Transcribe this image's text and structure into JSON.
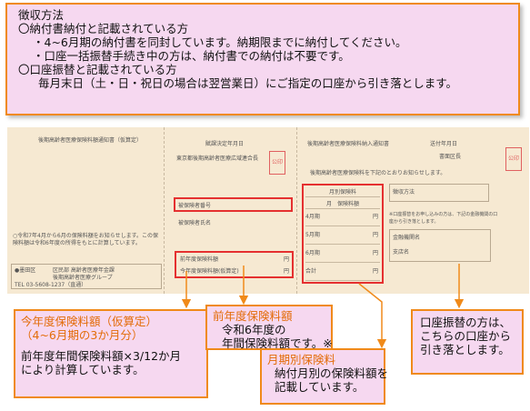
{
  "top_box": {
    "lines": [
      "徴収方法",
      "〇納付書納付と記載されている方",
      "・4~6月期の納付書を同封しています。納期限までに納付してください。",
      "・口座一括振替手続き中の方は、納付書での納付は不要です。",
      "〇口座振替と記載されている方",
      "毎月末日（土・日・祝日の場合は翌営業日）にご指定の口座から引き落とします。"
    ]
  },
  "notice": {
    "left_title": "後期高齢者医療保険料額通知書（仮算定）",
    "center_title": "賦課決定年月日",
    "center_org": "東京都後期高齢者医療広域連合長",
    "stamp": "公印",
    "right_title": "後期高齢者医療保険料納入通知書",
    "right_date": "送付年月日",
    "right_issuer": "書面区長",
    "right_intro": "後期高齢者医療保険料を下記のとおりお知らせします。",
    "insured_number": "被保険者番号",
    "insured_name": "被保険者氏名",
    "prev_year_premium": "前年度保険料額",
    "current_year_premium": "今年度保険料額(仮算定)",
    "yen": "円",
    "monthly_table_title": "月別保険料",
    "monthly_header": "月　保険料額",
    "monthly_rows": [
      "4月期",
      "5月期",
      "6月期",
      "合計"
    ],
    "collection_method": "徴収方法",
    "transfer_note": "※口座振替をお申し込みの方は、下記の金融機関の口座から引き落とします。",
    "bank_name": "金融機関名",
    "bank_branch": "支店名",
    "left_note": "○令和7年4月から6月の保険料額をお知らせします。この保険料額は令和6年度の所得をもとに計算しています。",
    "footer_ward": "●墨田区",
    "footer_dept": "区民部 高齢者医療年金課",
    "footer_group": "後期高齢者医療グループ",
    "footer_tel": "TEL 03-5608-1237（直通）"
  },
  "callouts": {
    "current_year": {
      "heading_1": "今年度保険料額（仮算定）",
      "heading_2": "（4~6月期の3か月分）",
      "body_1": "前年度年間保険料額×3/12か月",
      "body_2": "により計算しています。"
    },
    "prev_year": {
      "heading": "前年度保険料額",
      "body_1": "令和6年度の",
      "body_2": "年間保険料額です。※"
    },
    "monthly": {
      "heading": "月期別保険料",
      "body_1": "納付月別の保険料額を",
      "body_2": "記載しています。"
    },
    "transfer": {
      "body_1": "口座振替の方は、",
      "body_2": "こちらの口座から",
      "body_3": "引き落とします。"
    }
  },
  "colors": {
    "callout_fill": "#f6d8f0",
    "callout_border": "#f08a1a",
    "heading_text": "#e36c09",
    "highlight_red": "#e53030",
    "notice_paper": "#f6e9d2"
  }
}
